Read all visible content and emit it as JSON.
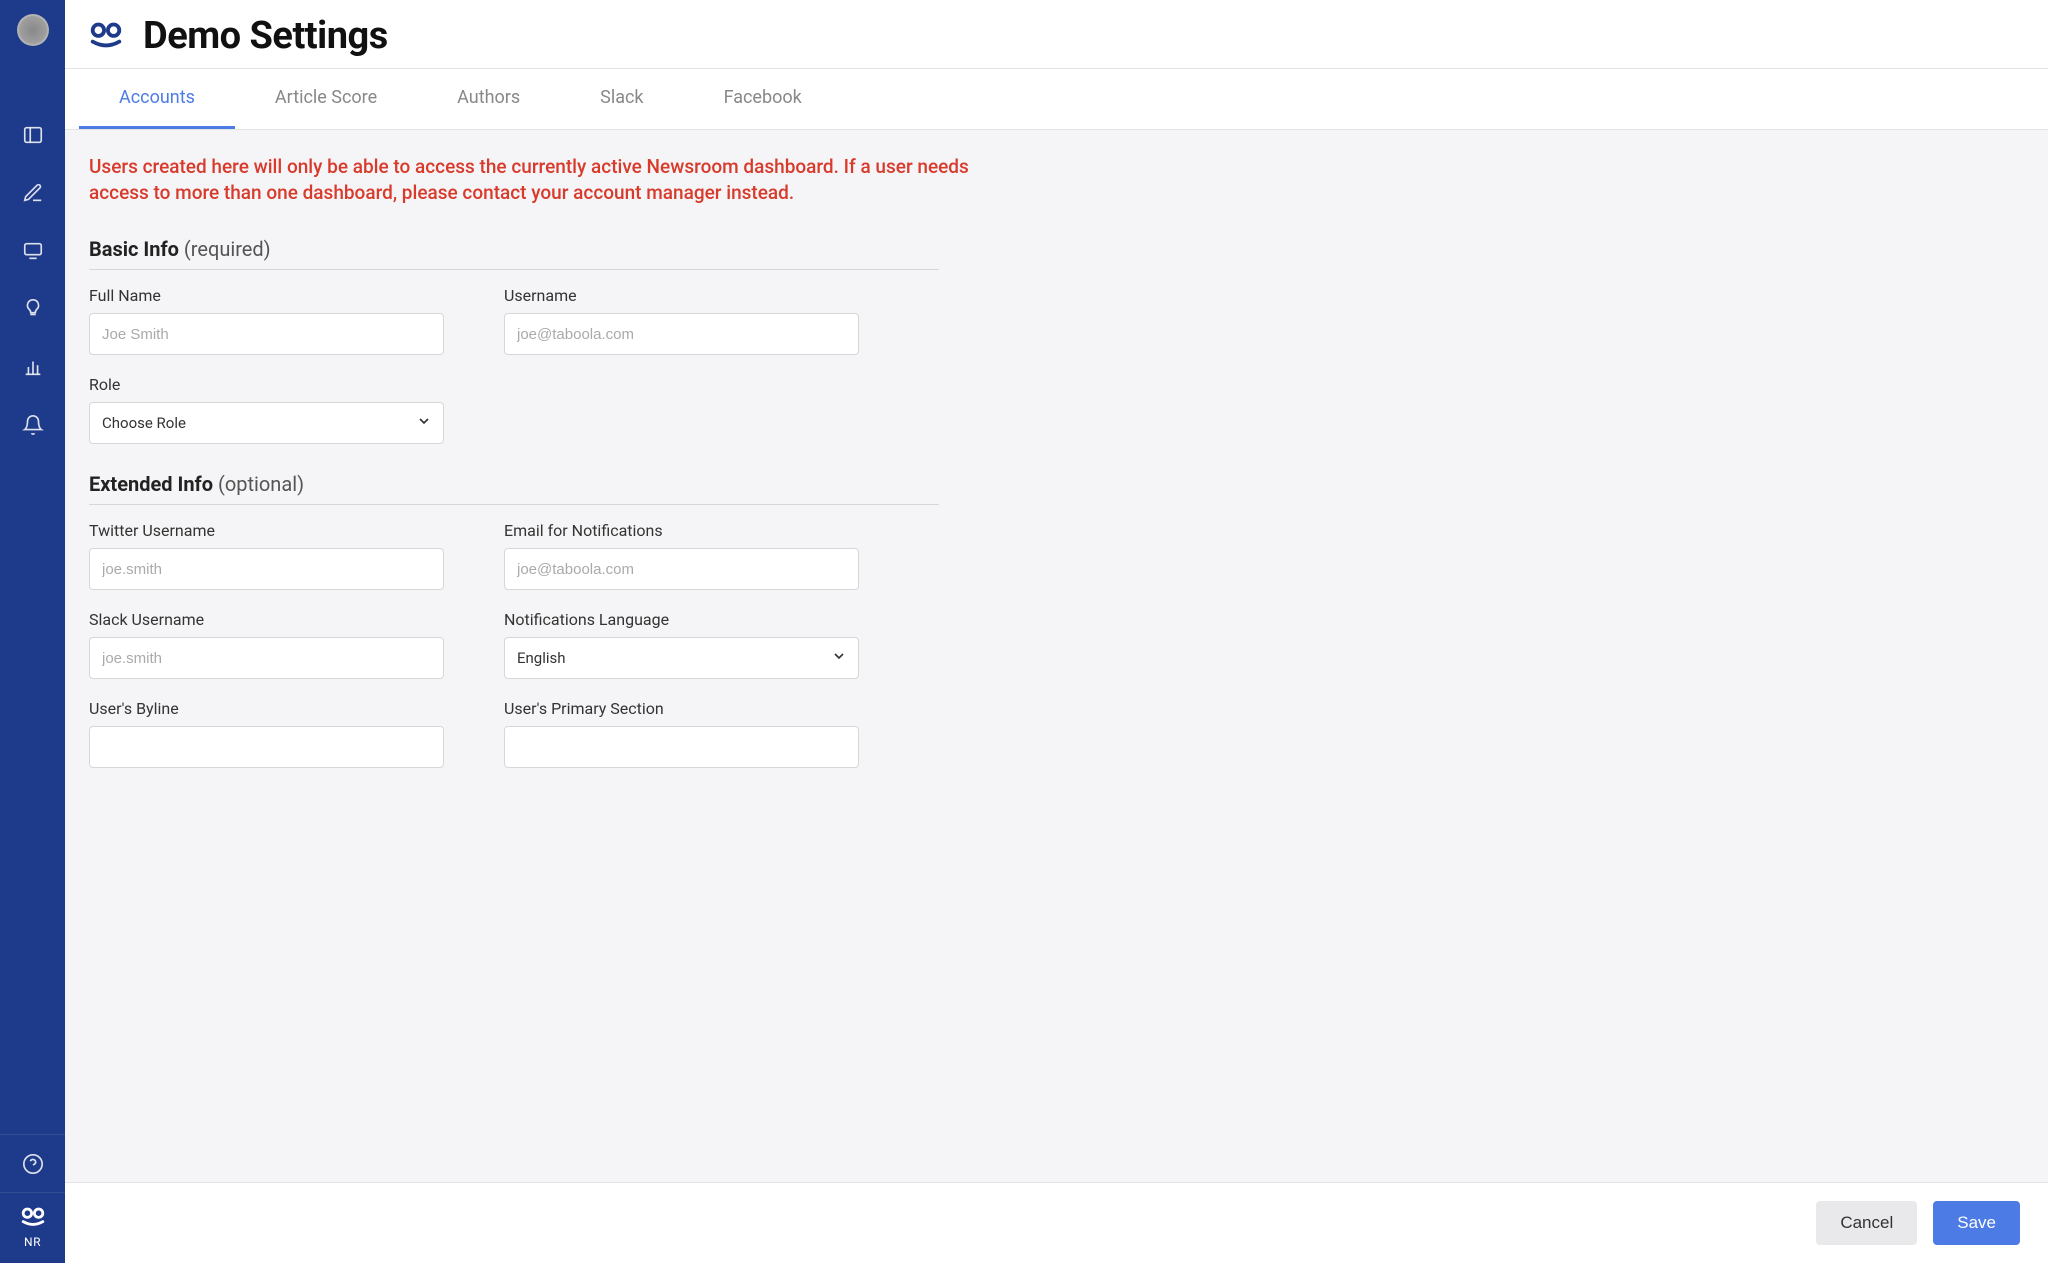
{
  "sidebar": {
    "logo_label": "NR"
  },
  "header": {
    "title": "Demo Settings"
  },
  "tabs": [
    {
      "label": "Accounts",
      "active": true
    },
    {
      "label": "Article Score",
      "active": false
    },
    {
      "label": "Authors",
      "active": false
    },
    {
      "label": "Slack",
      "active": false
    },
    {
      "label": "Facebook",
      "active": false
    }
  ],
  "warning": "Users created here will only be able to access the currently active Newsroom dashboard. If a user needs access to more than one dashboard, please contact your account manager instead.",
  "sections": {
    "basic": {
      "title_bold": "Basic Info",
      "title_paren": "(required)",
      "fields": {
        "full_name": {
          "label": "Full Name",
          "placeholder": "Joe Smith",
          "value": ""
        },
        "username": {
          "label": "Username",
          "placeholder": "joe@taboola.com",
          "value": ""
        },
        "role": {
          "label": "Role",
          "selected": "Choose Role"
        }
      }
    },
    "extended": {
      "title_bold": "Extended Info",
      "title_paren": "(optional)",
      "fields": {
        "twitter": {
          "label": "Twitter Username",
          "placeholder": "joe.smith",
          "value": ""
        },
        "email_notif": {
          "label": "Email for Notifications",
          "placeholder": "joe@taboola.com",
          "value": ""
        },
        "slack": {
          "label": "Slack Username",
          "placeholder": "joe.smith",
          "value": ""
        },
        "notif_lang": {
          "label": "Notifications Language",
          "selected": "English"
        },
        "byline": {
          "label": "User's Byline",
          "placeholder": "",
          "value": ""
        },
        "primary_section": {
          "label": "User's Primary Section",
          "placeholder": "",
          "value": ""
        }
      }
    }
  },
  "footer": {
    "cancel": "Cancel",
    "save": "Save"
  }
}
